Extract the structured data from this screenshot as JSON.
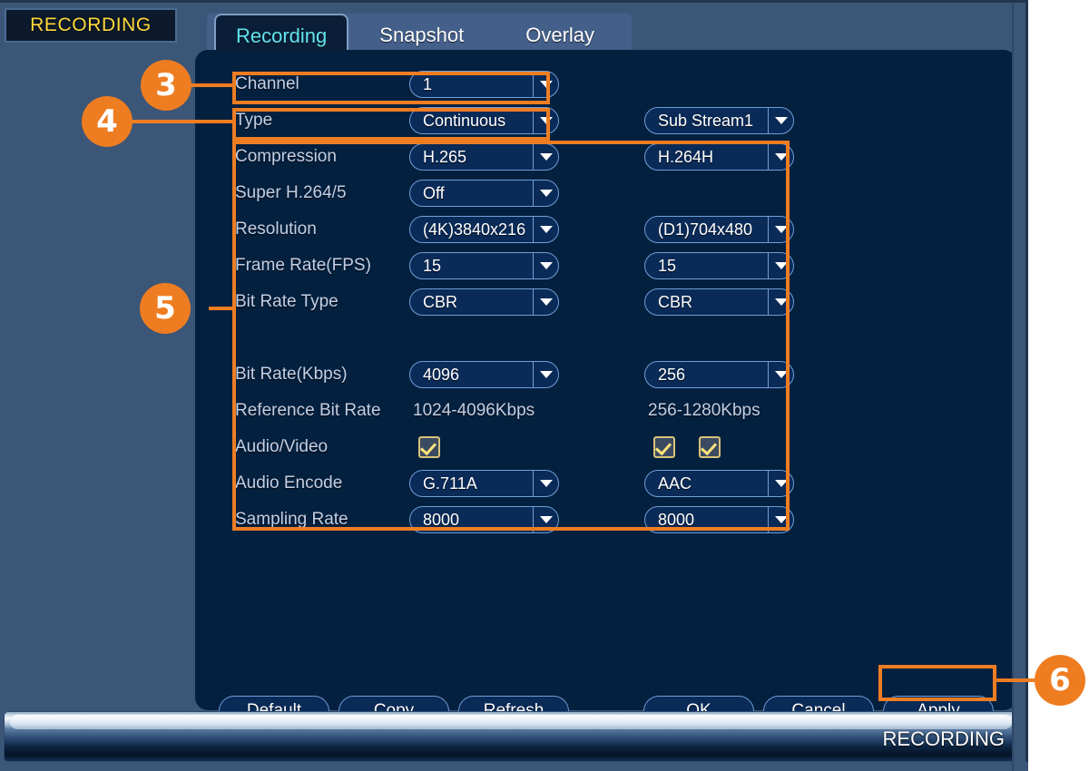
{
  "status_badge": {
    "label": "RECORDING"
  },
  "tabs": [
    {
      "label": "Recording",
      "active": true
    },
    {
      "label": "Snapshot",
      "active": false
    },
    {
      "label": "Overlay",
      "active": false
    }
  ],
  "form": {
    "rows": [
      {
        "label": "Channel",
        "main_type": "dropdown",
        "main_value": "1",
        "sub_type": "none",
        "sub_value": ""
      },
      {
        "label": "Type",
        "main_type": "dropdown",
        "main_value": "Continuous",
        "sub_type": "dropdown",
        "sub_value": "Sub Stream1"
      },
      {
        "label": "Compression",
        "main_type": "dropdown",
        "main_value": "H.265",
        "sub_type": "dropdown",
        "sub_value": "H.264H"
      },
      {
        "label": "Super H.264/5",
        "main_type": "dropdown",
        "main_value": "Off",
        "sub_type": "none",
        "sub_value": ""
      },
      {
        "label": "Resolution",
        "main_type": "dropdown",
        "main_value": "(4K)3840x216",
        "sub_type": "dropdown",
        "sub_value": "(D1)704x480"
      },
      {
        "label": "Frame Rate(FPS)",
        "main_type": "dropdown",
        "main_value": "15",
        "sub_type": "dropdown",
        "sub_value": "15"
      },
      {
        "label": "Bit Rate Type",
        "main_type": "dropdown",
        "main_value": "CBR",
        "sub_type": "dropdown",
        "sub_value": "CBR"
      },
      {
        "label": "",
        "main_type": "none",
        "main_value": "",
        "sub_type": "none",
        "sub_value": ""
      },
      {
        "label": "Bit Rate(Kbps)",
        "main_type": "dropdown",
        "main_value": "4096",
        "sub_type": "dropdown",
        "sub_value": "256"
      },
      {
        "label": "Reference Bit Rate",
        "main_type": "text",
        "main_value": "1024-4096Kbps",
        "sub_type": "text",
        "sub_value": "256-1280Kbps"
      },
      {
        "label": "Audio/Video",
        "main_type": "checkbox",
        "main_value": "checked",
        "sub_type": "checkbox2",
        "sub_value": "checked"
      },
      {
        "label": "Audio Encode",
        "main_type": "dropdown",
        "main_value": "G.711A",
        "sub_type": "dropdown",
        "sub_value": "AAC"
      },
      {
        "label": "Sampling Rate",
        "main_type": "dropdown",
        "main_value": "8000",
        "sub_type": "dropdown",
        "sub_value": "8000"
      }
    ]
  },
  "buttons": {
    "default": "Default",
    "copy": "Copy",
    "refresh": "Refresh",
    "ok": "OK",
    "cancel": "Cancel",
    "apply": "Apply"
  },
  "callouts": [
    {
      "number": "3"
    },
    {
      "number": "4"
    },
    {
      "number": "5"
    },
    {
      "number": "6"
    }
  ],
  "footer": {
    "status_text": "RECORDING"
  },
  "colors": {
    "accent_orange": "#ee7d22",
    "screen_bg": "#3c5678",
    "dialog_bg": "#04203f",
    "field_bg": "#0a2a57",
    "field_border": "#6f9fd8",
    "active_tab_text": "#62e4ef",
    "badge_text": "#ffd93d",
    "checkbox_border": "#d9c27a",
    "checkbox_check": "#ffe27a"
  }
}
